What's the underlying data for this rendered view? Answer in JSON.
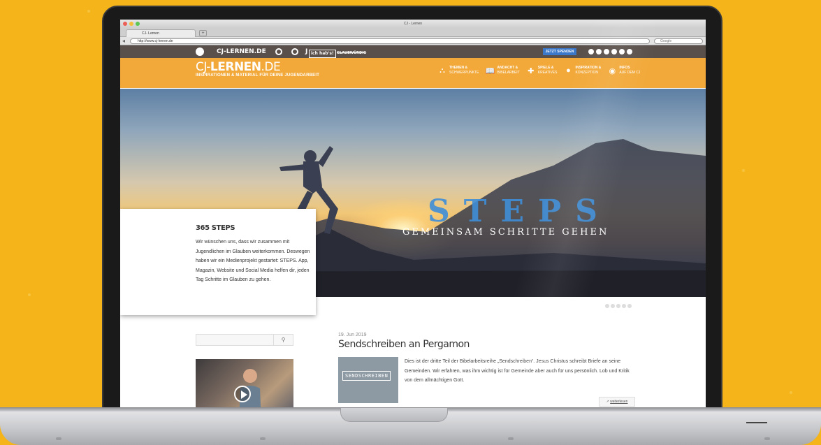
{
  "browser": {
    "window_title": "CJ - Lernen",
    "tab_label": "CJ- Lernen",
    "new_tab": "+",
    "url": "http://www.cj-lernen.de",
    "search_placeholder": "Google"
  },
  "topbar": {
    "brands": [
      "CJ-LERNEN.DE",
      "J",
      "ich hab's!",
      "GLAUBWÜRDIG"
    ],
    "donate_label": "JETZT SPENDEN"
  },
  "header": {
    "logo_light": "CJ-",
    "logo_bold": "LERNEN",
    "logo_tld": ".DE",
    "tagline": "INSPIRATIONEN & MATERIAL FÜR DEINE JUGENDARBEIT",
    "nav": [
      {
        "title": "THEMEN &",
        "sub": "SCHWERPUNKTE",
        "icon": "sitemap-icon"
      },
      {
        "title": "ANDACHT &",
        "sub": "BIBELARBEIT",
        "icon": "book-icon"
      },
      {
        "title": "SPIELE &",
        "sub": "KREATIVES",
        "icon": "puzzle-icon"
      },
      {
        "title": "INSPIRATION &",
        "sub": "KONZEPTION",
        "icon": "lightbulb-icon"
      },
      {
        "title": "INFOS",
        "sub": "AUF DEM CJ",
        "icon": "cj-icon"
      }
    ]
  },
  "hero": {
    "headline": "STEPS",
    "subline": "GEMEINSAM SCHRITTE GEHEN",
    "card_title": "365 STEPS",
    "card_text": "Wir wünschen uns, dass wir zusammen mit Jugendlichen im Glauben weiterkommen. Deswegen haben wir ein Medienprojekt gestartet: STEPS. App, Magazin, Website und Social Media helfen dir, jeden Tag Schritte im Glauben zu gehen."
  },
  "sidebar": {
    "search_icon": "magnifier-icon"
  },
  "post": {
    "date": "19. Jun 2019",
    "title": "Sendschreiben an Pergamon",
    "thumb_text": "SENDSCHREIBEN",
    "excerpt": "Dies ist der dritte Teil der Bibelarbeitsreihe „Sendschreiben“. Jesus Christus schreibt Briefe an seine Gemeinden. Wir erfahren, was ihm wichtig ist für Gemeinde aber auch für uns persönlich. Lob und Kritik von dem allmächtigen Gott.",
    "more_label": "weiterlesen"
  },
  "colors": {
    "background": "#f4b41a",
    "header": "#f2a93a",
    "topstrip": "#5a504b",
    "steps_blue": "#3f8ed8",
    "donate": "#3b78c9"
  }
}
